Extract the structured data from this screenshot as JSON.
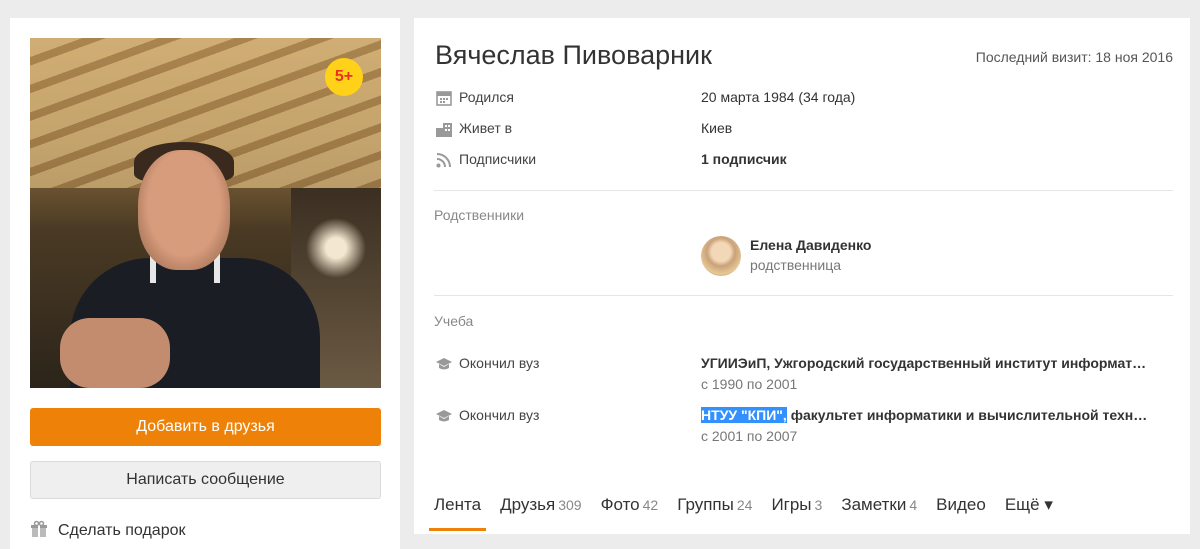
{
  "profile": {
    "name": "Вячеслав Пивоварник",
    "last_visit": "Последний визит: 18 ноя 2016",
    "badge": "5+"
  },
  "actions": {
    "add_friend": "Добавить в друзья",
    "send_message": "Написать сообщение",
    "gift": "Сделать подарок"
  },
  "info": [
    {
      "icon": "calendar-icon",
      "label": "Родился",
      "value": "20 марта 1984 (34 года)"
    },
    {
      "icon": "city-icon",
      "label": "Живет в",
      "value": "Киев"
    },
    {
      "icon": "rss-icon",
      "label": "Подписчики",
      "value": "1 подписчик"
    }
  ],
  "relatives": {
    "title": "Родственники",
    "items": [
      {
        "name": "Елена Давиденко",
        "role": "родственница"
      }
    ]
  },
  "education": {
    "title": "Учеба",
    "items": [
      {
        "label": "Окончил вуз",
        "value": "УГИИЭиП, Ужгородский государственный институт информат…",
        "highlight": "",
        "years": "с 1990 по 2001"
      },
      {
        "label": "Окончил вуз",
        "value": "факультет информатики и вычислительной техн…",
        "highlight": "НТУУ \"КПИ\",",
        "years": "с 2001 по 2007"
      }
    ]
  },
  "tabs": [
    {
      "label": "Лента",
      "count": "",
      "active": true
    },
    {
      "label": "Друзья",
      "count": "309"
    },
    {
      "label": "Фото",
      "count": "42"
    },
    {
      "label": "Группы",
      "count": "24"
    },
    {
      "label": "Игры",
      "count": "3"
    },
    {
      "label": "Заметки",
      "count": "4"
    },
    {
      "label": "Видео",
      "count": ""
    },
    {
      "label": "Ещё ▾",
      "count": ""
    }
  ],
  "colors": {
    "accent": "#ee8208",
    "badge": "#ffd219",
    "selection": "#3390ff"
  }
}
